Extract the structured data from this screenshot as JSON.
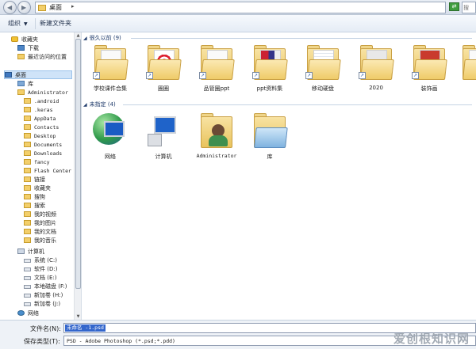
{
  "address_bar": {
    "path": "桌面",
    "search_placeholder": "搜"
  },
  "toolbar": {
    "organize_label": "组织",
    "new_folder_label": "新建文件夹"
  },
  "sidebar": {
    "items": [
      {
        "label": "收藏夹",
        "icon": "star-icon"
      },
      {
        "label": "下载",
        "icon": "download-icon"
      },
      {
        "label": "最近访问的位置",
        "icon": "recent-icon"
      },
      {
        "label": "桌面",
        "icon": "desktop-icon"
      },
      {
        "label": "库",
        "icon": "library-icon"
      },
      {
        "label": "Administrator",
        "icon": "user-folder-icon"
      },
      {
        "label": ".android",
        "icon": "folder-icon"
      },
      {
        "label": ".keras",
        "icon": "folder-icon"
      },
      {
        "label": "AppData",
        "icon": "folder-icon"
      },
      {
        "label": "Contacts",
        "icon": "folder-icon"
      },
      {
        "label": "Desktop",
        "icon": "folder-icon"
      },
      {
        "label": "Documents",
        "icon": "folder-icon"
      },
      {
        "label": "Downloads",
        "icon": "folder-icon"
      },
      {
        "label": "fancy",
        "icon": "folder-icon"
      },
      {
        "label": "Flash Center",
        "icon": "folder-icon"
      },
      {
        "label": "链接",
        "icon": "folder-icon"
      },
      {
        "label": "收藏夹",
        "icon": "folder-icon"
      },
      {
        "label": "搜狗",
        "icon": "folder-icon"
      },
      {
        "label": "搜索",
        "icon": "folder-icon"
      },
      {
        "label": "我的视频",
        "icon": "folder-icon"
      },
      {
        "label": "我的图片",
        "icon": "folder-icon"
      },
      {
        "label": "我的文档",
        "icon": "folder-icon"
      },
      {
        "label": "我的音乐",
        "icon": "folder-icon"
      },
      {
        "label": "计算机",
        "icon": "computer-icon"
      },
      {
        "label": "系统 (C:)",
        "icon": "drive-icon"
      },
      {
        "label": "软件 (D:)",
        "icon": "drive-icon"
      },
      {
        "label": "文档 (E:)",
        "icon": "drive-icon"
      },
      {
        "label": "本地磁盘 (F:)",
        "icon": "drive-icon"
      },
      {
        "label": "新加卷 (H:)",
        "icon": "drive-icon"
      },
      {
        "label": "新加卷 (J:)",
        "icon": "drive-icon"
      },
      {
        "label": "网络",
        "icon": "network-icon"
      }
    ]
  },
  "main": {
    "groups": [
      {
        "header": "很久以前 (9)",
        "items": [
          {
            "label": "学校课件合集",
            "kind": "folder-icon"
          },
          {
            "label": "圈圈",
            "kind": "folder-icon"
          },
          {
            "label": "品管圈ppt",
            "kind": "folder-icon"
          },
          {
            "label": "ppt资料集",
            "kind": "folder-icon"
          },
          {
            "label": "移动硬盘",
            "kind": "folder-icon"
          },
          {
            "label": "2020",
            "kind": "folder-icon"
          },
          {
            "label": "装饰画",
            "kind": "folder-icon"
          }
        ]
      },
      {
        "header": "未指定 (4)",
        "items": [
          {
            "label": "网络",
            "kind": "network-icon"
          },
          {
            "label": "计算机",
            "kind": "computer-icon"
          },
          {
            "label": "Administrator",
            "kind": "user-folder-icon"
          },
          {
            "label": "库",
            "kind": "library-icon"
          }
        ]
      }
    ]
  },
  "bottom": {
    "filename_label": "文件名(N):",
    "filename_value": "未命名 -1.psd",
    "filetype_label": "保存类型(T):",
    "filetype_value": "PSD - Adobe Photoshop (*.psd;*.pdd)"
  },
  "watermark": "爱创根知识网",
  "colors": {
    "selection": "#3366cc",
    "tree_selected": "#cfe3f8",
    "folder_yellow": "#efcb68"
  }
}
